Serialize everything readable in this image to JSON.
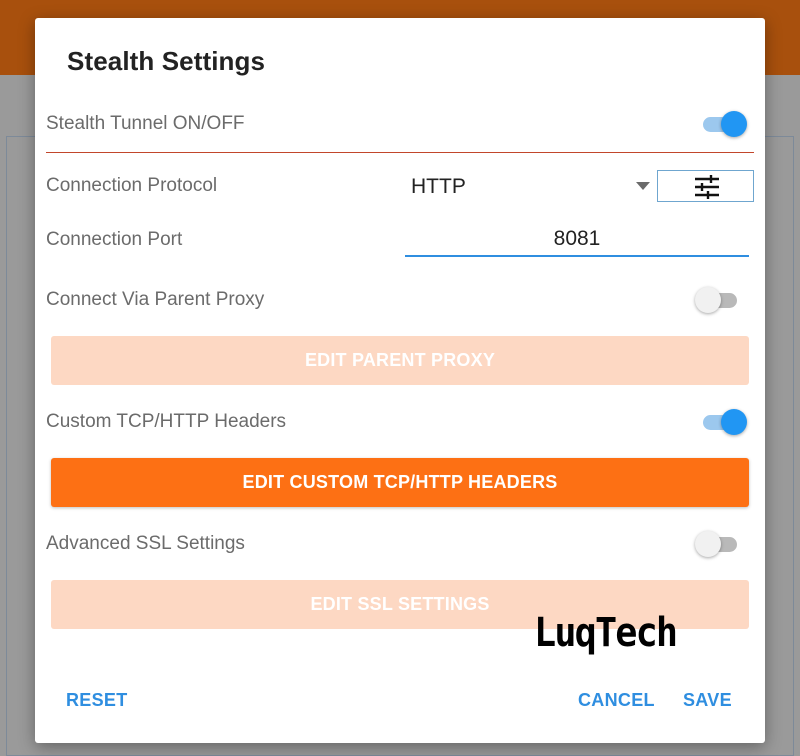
{
  "dialog": {
    "title": "Stealth Settings",
    "stealth_tunnel": {
      "label": "Stealth Tunnel ON/OFF",
      "enabled": true
    },
    "connection_protocol": {
      "label": "Connection Protocol",
      "value": "HTTP",
      "settings_icon": "sliders-icon"
    },
    "connection_port": {
      "label": "Connection Port",
      "value": "8081"
    },
    "parent_proxy": {
      "label": "Connect Via Parent Proxy",
      "enabled": false,
      "button_label": "EDIT PARENT PROXY"
    },
    "custom_headers": {
      "label": "Custom TCP/HTTP Headers",
      "enabled": true,
      "button_label": "EDIT CUSTOM TCP/HTTP HEADERS"
    },
    "ssl": {
      "label": "Advanced SSL Settings",
      "enabled": false,
      "button_label": "EDIT SSL SETTINGS"
    },
    "footer": {
      "reset": "RESET",
      "cancel": "CANCEL",
      "save": "SAVE"
    }
  },
  "watermark": "LuqTech",
  "colors": {
    "accent_orange": "#fd7014",
    "disabled_orange": "#fdd8c3",
    "toggle_on": "#2196f3",
    "link_blue": "#2f8ee0",
    "divider_red": "#c2462b"
  }
}
